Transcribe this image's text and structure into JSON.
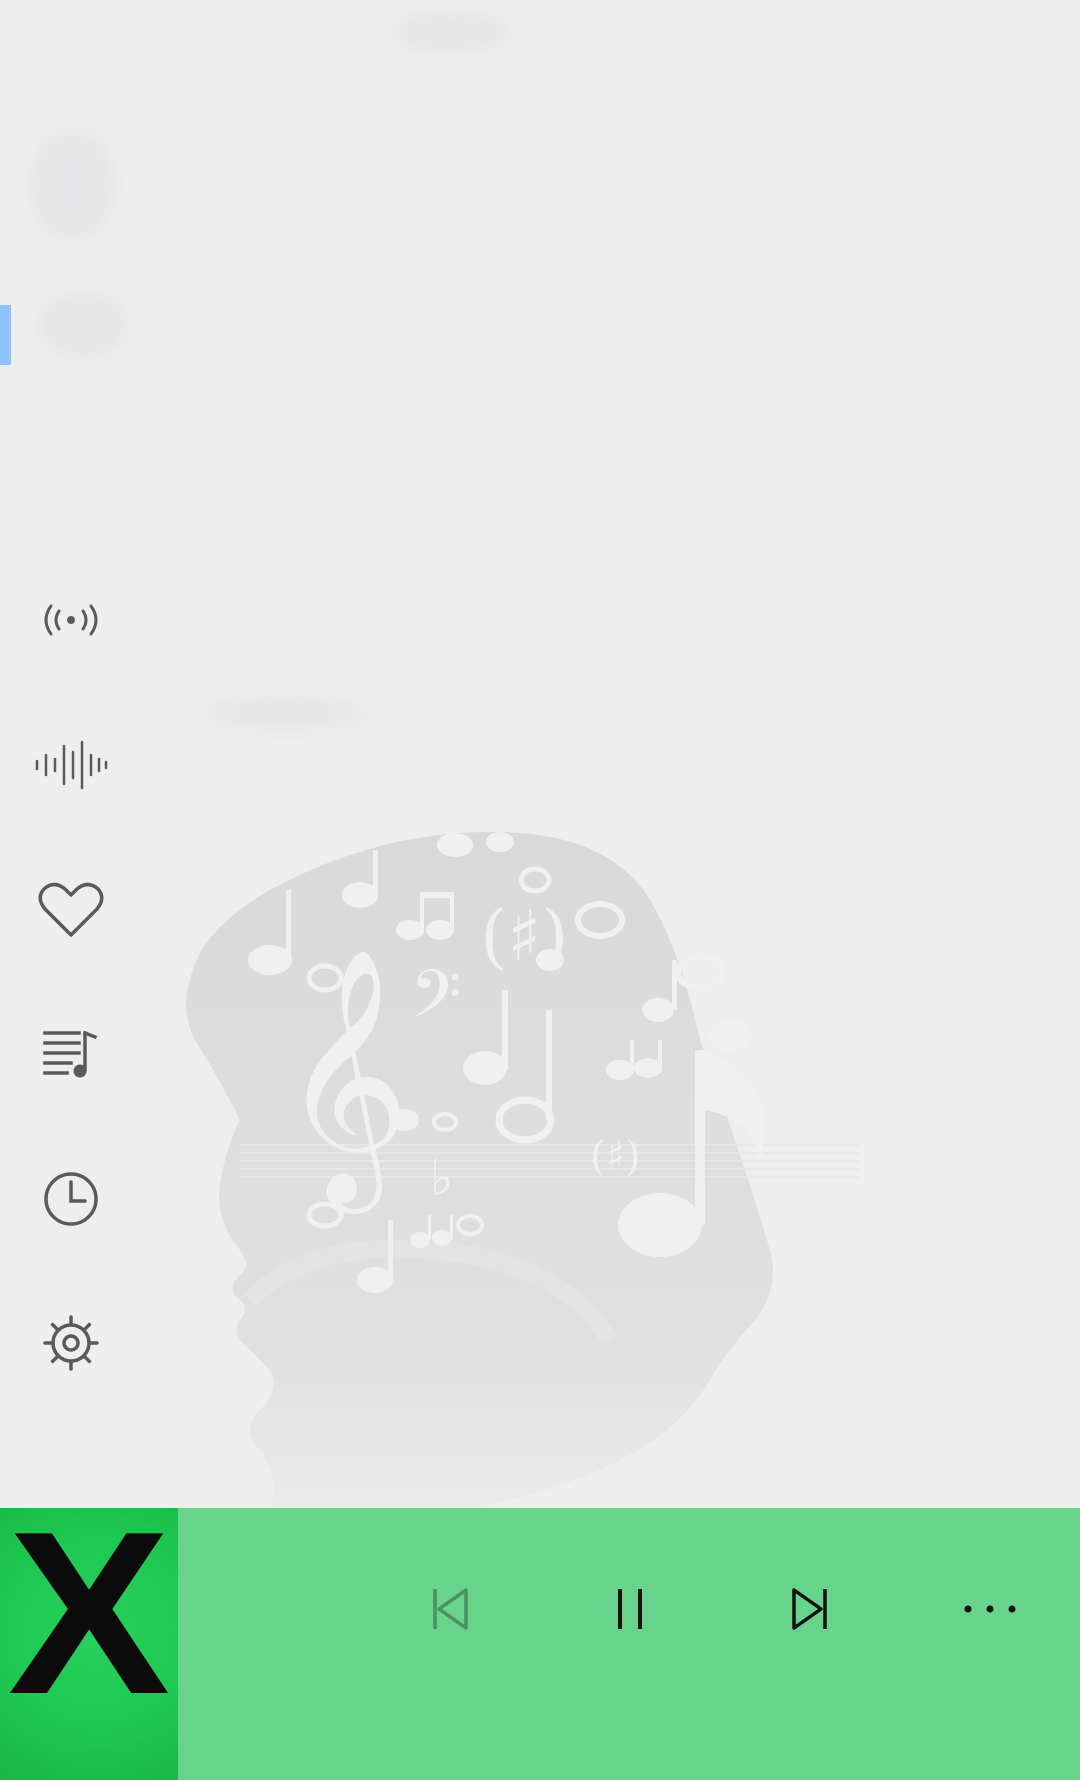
{
  "sidebar": {
    "items": [
      {
        "icon": "radio-broadcast-icon"
      },
      {
        "icon": "audio-waveform-icon"
      },
      {
        "icon": "heart-icon"
      },
      {
        "icon": "playlist-icon"
      },
      {
        "icon": "clock-icon"
      },
      {
        "icon": "settings-gear-icon"
      }
    ],
    "active_indicator_color": "#8cc4fb"
  },
  "background": {
    "art": "music-head-silhouette-icon"
  },
  "player": {
    "background_color": "#68d48b",
    "album_art": {
      "letter": "X",
      "background_color": "#1ec751"
    },
    "controls": [
      {
        "icon": "previous-icon",
        "enabled": false
      },
      {
        "icon": "pause-icon",
        "enabled": true
      },
      {
        "icon": "next-icon",
        "enabled": true
      },
      {
        "icon": "more-options-icon",
        "enabled": true
      }
    ]
  }
}
